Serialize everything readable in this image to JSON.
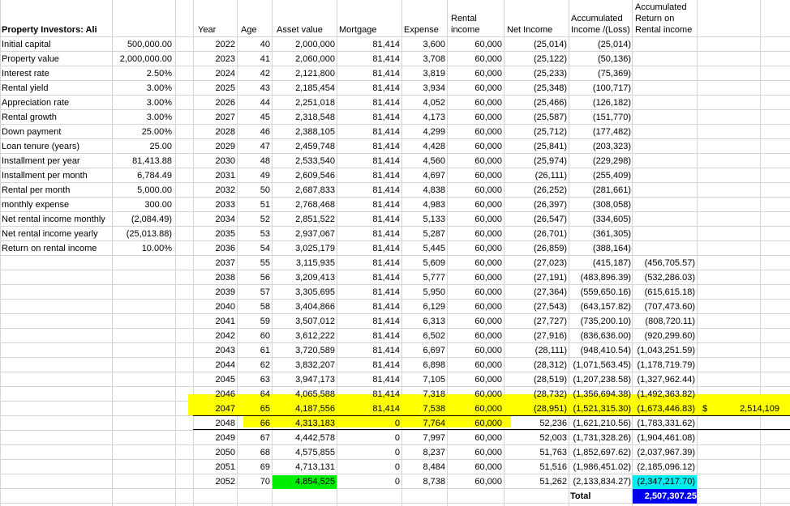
{
  "sheet": {
    "title": "Property Investors: Ali",
    "headers": {
      "year": "Year",
      "age": "Age",
      "asset_value": "Asset value",
      "mortgage": "Mortgage",
      "expense": "Expense",
      "rental_income_l1": "Rental",
      "rental_income_l2": "income",
      "net_income": "Net Income",
      "accum_income_l1": "Accumulated",
      "accum_income_l2": "Income /(Loss)",
      "accum_return_l1": "Accumulated",
      "accum_return_l2": "Return on",
      "accum_return_l3": "Rental income"
    },
    "params": [
      {
        "label": "Initial capital",
        "value": "500,000.00"
      },
      {
        "label": "Property value",
        "value": "2,000,000.00"
      },
      {
        "label": "Interest rate",
        "value": "2.50%"
      },
      {
        "label": "Rental yield",
        "value": "3.00%"
      },
      {
        "label": "Appreciation rate",
        "value": "3.00%"
      },
      {
        "label": "Rental growth",
        "value": "3.00%"
      },
      {
        "label": "Down payment",
        "value": "25.00%"
      },
      {
        "label": "Loan tenure (years)",
        "value": "25.00"
      },
      {
        "label": "Installment per year",
        "value": "81,413.88"
      },
      {
        "label": "Installment per month",
        "value": "6,784.49"
      },
      {
        "label": "Rental per month",
        "value": "5,000.00"
      },
      {
        "label": "monthly expense",
        "value": "300.00"
      },
      {
        "label": "Net rental income monthly",
        "value": "(2,084.49)"
      },
      {
        "label": "Net rental income yearly",
        "value": "(25,013.88)"
      },
      {
        "label": "Return on rental income",
        "value": "10.00%"
      }
    ],
    "rows": [
      {
        "year": "2022",
        "age": "40",
        "asset": "2,000,000",
        "mortgage": "81,414",
        "expense": "3,600",
        "rental": "60,000",
        "net": "(25,014)",
        "accum_income": "(25,014)",
        "accum_return": ""
      },
      {
        "year": "2023",
        "age": "41",
        "asset": "2,060,000",
        "mortgage": "81,414",
        "expense": "3,708",
        "rental": "60,000",
        "net": "(25,122)",
        "accum_income": "(50,136)",
        "accum_return": ""
      },
      {
        "year": "2024",
        "age": "42",
        "asset": "2,121,800",
        "mortgage": "81,414",
        "expense": "3,819",
        "rental": "60,000",
        "net": "(25,233)",
        "accum_income": "(75,369)",
        "accum_return": ""
      },
      {
        "year": "2025",
        "age": "43",
        "asset": "2,185,454",
        "mortgage": "81,414",
        "expense": "3,934",
        "rental": "60,000",
        "net": "(25,348)",
        "accum_income": "(100,717)",
        "accum_return": ""
      },
      {
        "year": "2026",
        "age": "44",
        "asset": "2,251,018",
        "mortgage": "81,414",
        "expense": "4,052",
        "rental": "60,000",
        "net": "(25,466)",
        "accum_income": "(126,182)",
        "accum_return": ""
      },
      {
        "year": "2027",
        "age": "45",
        "asset": "2,318,548",
        "mortgage": "81,414",
        "expense": "4,173",
        "rental": "60,000",
        "net": "(25,587)",
        "accum_income": "(151,770)",
        "accum_return": ""
      },
      {
        "year": "2028",
        "age": "46",
        "asset": "2,388,105",
        "mortgage": "81,414",
        "expense": "4,299",
        "rental": "60,000",
        "net": "(25,712)",
        "accum_income": "(177,482)",
        "accum_return": ""
      },
      {
        "year": "2029",
        "age": "47",
        "asset": "2,459,748",
        "mortgage": "81,414",
        "expense": "4,428",
        "rental": "60,000",
        "net": "(25,841)",
        "accum_income": "(203,323)",
        "accum_return": ""
      },
      {
        "year": "2030",
        "age": "48",
        "asset": "2,533,540",
        "mortgage": "81,414",
        "expense": "4,560",
        "rental": "60,000",
        "net": "(25,974)",
        "accum_income": "(229,298)",
        "accum_return": ""
      },
      {
        "year": "2031",
        "age": "49",
        "asset": "2,609,546",
        "mortgage": "81,414",
        "expense": "4,697",
        "rental": "60,000",
        "net": "(26,111)",
        "accum_income": "(255,409)",
        "accum_return": ""
      },
      {
        "year": "2032",
        "age": "50",
        "asset": "2,687,833",
        "mortgage": "81,414",
        "expense": "4,838",
        "rental": "60,000",
        "net": "(26,252)",
        "accum_income": "(281,661)",
        "accum_return": ""
      },
      {
        "year": "2033",
        "age": "51",
        "asset": "2,768,468",
        "mortgage": "81,414",
        "expense": "4,983",
        "rental": "60,000",
        "net": "(26,397)",
        "accum_income": "(308,058)",
        "accum_return": ""
      },
      {
        "year": "2034",
        "age": "52",
        "asset": "2,851,522",
        "mortgage": "81,414",
        "expense": "5,133",
        "rental": "60,000",
        "net": "(26,547)",
        "accum_income": "(334,605)",
        "accum_return": ""
      },
      {
        "year": "2035",
        "age": "53",
        "asset": "2,937,067",
        "mortgage": "81,414",
        "expense": "5,287",
        "rental": "60,000",
        "net": "(26,701)",
        "accum_income": "(361,305)",
        "accum_return": ""
      },
      {
        "year": "2036",
        "age": "54",
        "asset": "3,025,179",
        "mortgage": "81,414",
        "expense": "5,445",
        "rental": "60,000",
        "net": "(26,859)",
        "accum_income": "(388,164)",
        "accum_return": ""
      },
      {
        "year": "2037",
        "age": "55",
        "asset": "3,115,935",
        "mortgage": "81,414",
        "expense": "5,609",
        "rental": "60,000",
        "net": "(27,023)",
        "accum_income": "(415,187)",
        "accum_return": "(456,705.57)"
      },
      {
        "year": "2038",
        "age": "56",
        "asset": "3,209,413",
        "mortgage": "81,414",
        "expense": "5,777",
        "rental": "60,000",
        "net": "(27,191)",
        "accum_income": "(483,896.39)",
        "accum_return": "(532,286.03)"
      },
      {
        "year": "2039",
        "age": "57",
        "asset": "3,305,695",
        "mortgage": "81,414",
        "expense": "5,950",
        "rental": "60,000",
        "net": "(27,364)",
        "accum_income": "(559,650.16)",
        "accum_return": "(615,615.18)"
      },
      {
        "year": "2040",
        "age": "58",
        "asset": "3,404,866",
        "mortgage": "81,414",
        "expense": "6,129",
        "rental": "60,000",
        "net": "(27,543)",
        "accum_income": "(643,157.82)",
        "accum_return": "(707,473.60)"
      },
      {
        "year": "2041",
        "age": "59",
        "asset": "3,507,012",
        "mortgage": "81,414",
        "expense": "6,313",
        "rental": "60,000",
        "net": "(27,727)",
        "accum_income": "(735,200.10)",
        "accum_return": "(808,720.11)"
      },
      {
        "year": "2042",
        "age": "60",
        "asset": "3,612,222",
        "mortgage": "81,414",
        "expense": "6,502",
        "rental": "60,000",
        "net": "(27,916)",
        "accum_income": "(836,636.00)",
        "accum_return": "(920,299.60)"
      },
      {
        "year": "2043",
        "age": "61",
        "asset": "3,720,589",
        "mortgage": "81,414",
        "expense": "6,697",
        "rental": "60,000",
        "net": "(28,111)",
        "accum_income": "(948,410.54)",
        "accum_return": "(1,043,251.59)"
      },
      {
        "year": "2044",
        "age": "62",
        "asset": "3,832,207",
        "mortgage": "81,414",
        "expense": "6,898",
        "rental": "60,000",
        "net": "(28,312)",
        "accum_income": "(1,071,563.45)",
        "accum_return": "(1,178,719.79)"
      },
      {
        "year": "2045",
        "age": "63",
        "asset": "3,947,173",
        "mortgage": "81,414",
        "expense": "7,105",
        "rental": "60,000",
        "net": "(28,519)",
        "accum_income": "(1,207,238.58)",
        "accum_return": "(1,327,962.44)"
      },
      {
        "year": "2046",
        "age": "64",
        "asset": "4,065,588",
        "mortgage": "81,414",
        "expense": "7,318",
        "rental": "60,000",
        "net": "(28,732)",
        "accum_income": "(1,356,694.38)",
        "accum_return": "(1,492,363.82)"
      },
      {
        "year": "2047",
        "age": "65",
        "asset": "4,187,556",
        "mortgage": "81,414",
        "expense": "7,538",
        "rental": "60,000",
        "net": "(28,951)",
        "accum_income": "(1,521,315.30)",
        "accum_return": "(1,673,446.83)",
        "currency": "$",
        "extra": "2,514,109"
      },
      {
        "year": "2048",
        "age": "66",
        "asset": "4,313,183",
        "mortgage": "0",
        "expense": "7,764",
        "rental": "60,000",
        "net": "52,236",
        "accum_income": "(1,621,210.56)",
        "accum_return": "(1,783,331.62)"
      },
      {
        "year": "2049",
        "age": "67",
        "asset": "4,442,578",
        "mortgage": "0",
        "expense": "7,997",
        "rental": "60,000",
        "net": "52,003",
        "accum_income": "(1,731,328.26)",
        "accum_return": "(1,904,461.08)"
      },
      {
        "year": "2050",
        "age": "68",
        "asset": "4,575,855",
        "mortgage": "0",
        "expense": "8,237",
        "rental": "60,000",
        "net": "51,763",
        "accum_income": "(1,852,697.62)",
        "accum_return": "(2,037,967.39)"
      },
      {
        "year": "2051",
        "age": "69",
        "asset": "4,713,131",
        "mortgage": "0",
        "expense": "8,484",
        "rental": "60,000",
        "net": "51,516",
        "accum_income": "(1,986,451.02)",
        "accum_return": "(2,185,096.12)"
      },
      {
        "year": "2052",
        "age": "70",
        "asset": "4,854,525",
        "mortgage": "0",
        "expense": "8,738",
        "rental": "60,000",
        "net": "51,262",
        "accum_income": "(2,133,834.27)",
        "accum_return": "(2,347,217.70)"
      }
    ],
    "total_label": "Total",
    "total_value": "2,507,307.25",
    "colors": {
      "grid": "#d4d4d4",
      "highlight": "#ffff00",
      "green_cell": "#00ee00",
      "cyan_cell": "#00eeee",
      "total_cell": "#0000ee",
      "total_text": "#ffffff"
    }
  }
}
